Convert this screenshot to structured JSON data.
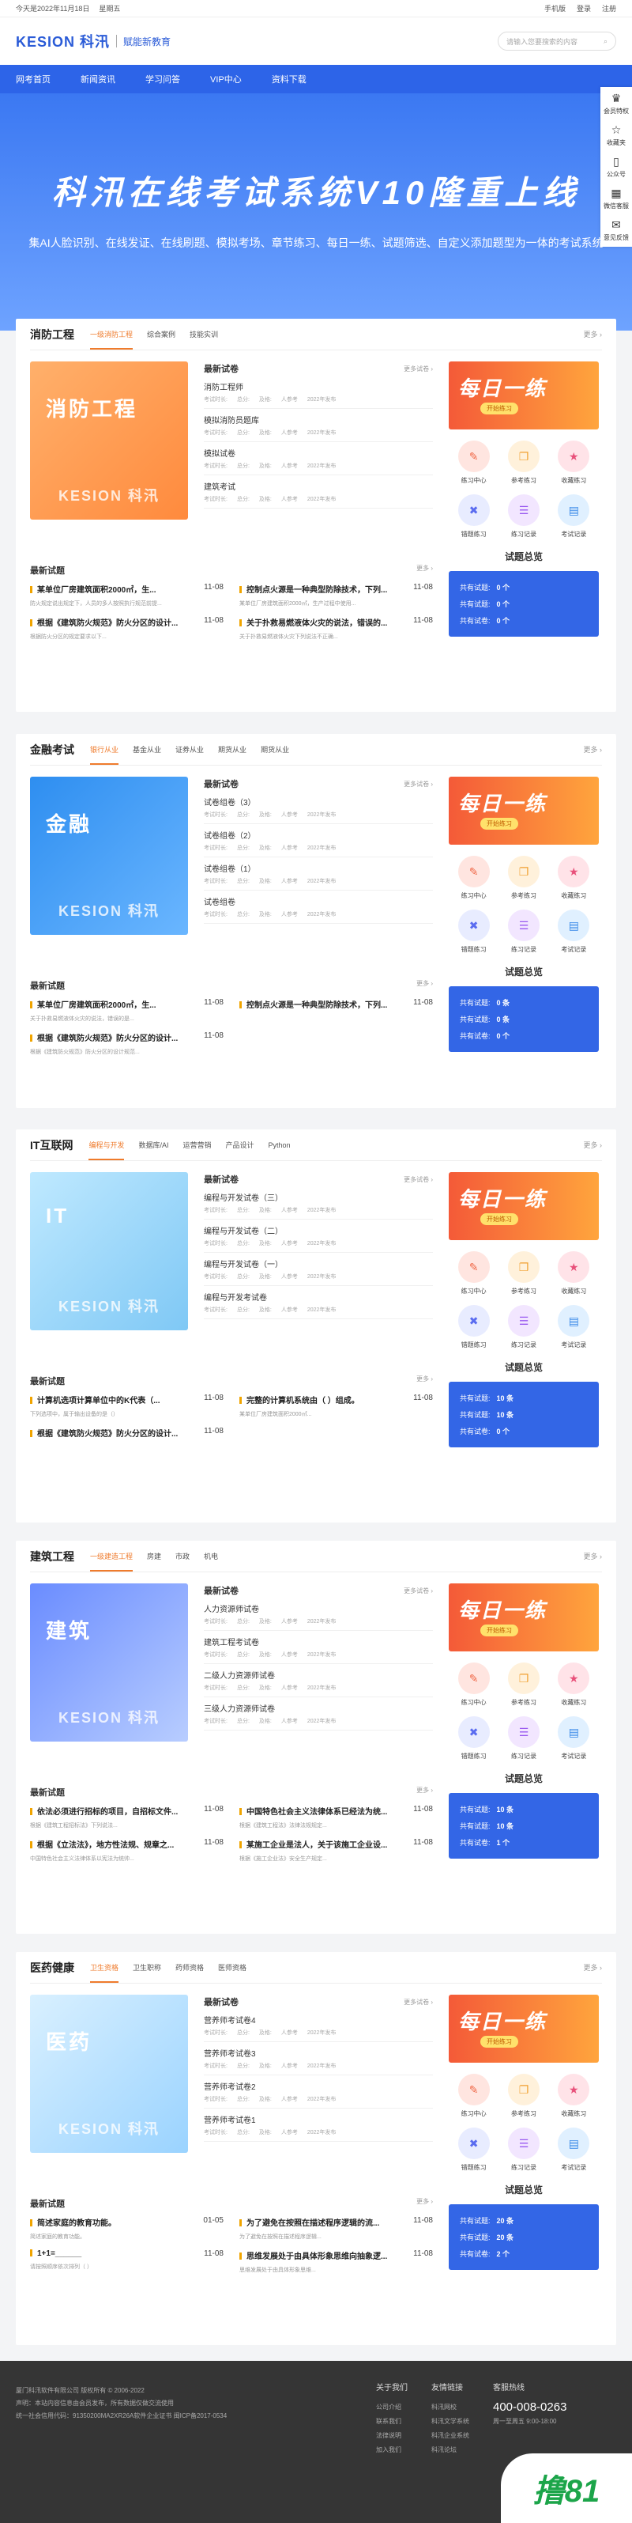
{
  "topbar": {
    "date": "今天是2022年11月18日",
    "weekday": "星期五",
    "links": [
      "手机版",
      "登录",
      "注册"
    ]
  },
  "header": {
    "brand": "KESION 科汛",
    "slogan": "赋能新教育",
    "search_placeholder": "请输入您要搜索的内容"
  },
  "nav": [
    "网考首页",
    "新闻资讯",
    "学习问答",
    "VIP中心",
    "资料下载"
  ],
  "banner": {
    "title": "科汛在线考试系统V10隆重上线",
    "subtitle": "集AI人脸识别、在线发证、在线刷题、模拟考场、章节练习、每日一练、试题筛选、自定义添加题型为一体的考试系统"
  },
  "sidebar": [
    {
      "icon": "crown-icon",
      "label": "会员特权"
    },
    {
      "icon": "star-icon",
      "label": "收藏夹"
    },
    {
      "icon": "phone-icon",
      "label": "公众号"
    },
    {
      "icon": "qrcode-icon",
      "label": "微信客服"
    },
    {
      "icon": "mail-icon",
      "label": "意见反馈"
    }
  ],
  "common": {
    "more": "更多 ›",
    "latest": "最新试卷",
    "more_exam": "更多试卷 ›",
    "latest_exam": "最新试题",
    "more_q": "更多 ›",
    "daily": "每日一练",
    "daily_btn": "开始练习",
    "summary": "试题总览",
    "icon_labels": [
      "练习中心",
      "参考练习",
      "收藏练习",
      "错题练习",
      "练习记录",
      "考试记录"
    ],
    "sum_labels": [
      "共有试题:",
      "共有试题:",
      "共有试卷:"
    ],
    "stat_labels": [
      "考试时长:",
      "总分:",
      "及格:",
      "人参考",
      "2022年发布"
    ]
  },
  "sections": [
    {
      "title": "消防工程",
      "tabs": [
        "一级消防工程",
        "综合案例",
        "技能实训"
      ],
      "img": "消防工程",
      "papers": [
        "消防工程师",
        "模拟消防员题库",
        "模拟试卷",
        "建筑考试"
      ],
      "exams": [
        [
          "某单位厂房建筑面积2000㎡，生...",
          "11-08",
          "防火规定说出规定下，人员的多人按照执行规范前提..."
        ],
        [
          "控制点火源是一种典型防除技术，下列...",
          "11-08",
          "某单位厂房建筑面积2000㎡，生产过程中使用..."
        ],
        [
          "根据《建筑防火规范》防火分区的设计...",
          "11-08",
          "根据防火分区的规定要求以下..."
        ],
        [
          "关于扑救易燃液体火灾的说法，错误的...",
          "11-08",
          "关于扑救易燃液体火灾下列说法不正确..."
        ]
      ],
      "sum": [
        "0 个",
        "0 个",
        "0 个"
      ]
    },
    {
      "title": "金融考试",
      "tabs": [
        "银行从业",
        "基金从业",
        "证券从业",
        "期货从业",
        "期货从业"
      ],
      "img": "金融",
      "papers": [
        "试卷组卷（3）",
        "试卷组卷（2）",
        "试卷组卷（1）",
        "试卷组卷"
      ],
      "exams": [
        [
          "某单位厂房建筑面积2000㎡，生...",
          "11-08",
          "关于扑救易燃液体火灾的说法，错误的是..."
        ],
        [
          "控制点火源是一种典型防除技术，下列...",
          "11-08",
          ""
        ],
        [
          "根据《建筑防火规范》防火分区的设计...",
          "11-08",
          "根据《建筑防火规范》防火分区的设计规范..."
        ]
      ],
      "sum": [
        "0 条",
        "0 条",
        "0 个"
      ]
    },
    {
      "title": "IT互联网",
      "tabs": [
        "编程与开发",
        "数据库/AI",
        "运营营销",
        "产品设计",
        "Python"
      ],
      "img": "IT",
      "papers": [
        "编程与开发试卷（三）",
        "编程与开发试卷（二）",
        "编程与开发试卷（一）",
        "编程与开发考试卷"
      ],
      "exams": [
        [
          "计算机选项计算单位中的K代表（...",
          "11-08",
          "下列选项中，属于输出设备的是（）"
        ],
        [
          "完整的计算机系统由（  ）组成。",
          "11-08",
          "某单位厂房建筑面积2000㎡..."
        ],
        [
          "根据《建筑防火规范》防火分区的设计...",
          "11-08",
          ""
        ]
      ],
      "sum": [
        "10 条",
        "10 条",
        "0 个"
      ]
    },
    {
      "title": "建筑工程",
      "tabs": [
        "一级建造工程",
        "房建",
        "市政",
        "机电"
      ],
      "img": "建筑",
      "papers": [
        "人力资源师试卷",
        "建筑工程考试卷",
        "二级人力资源师试卷",
        "三级人力资源师试卷"
      ],
      "exams": [
        [
          "依法必须进行招标的项目，自招标文件...",
          "11-08",
          "根据《建筑工程招标法》下列说法..."
        ],
        [
          "中国特色社会主义法律体系已经法为统...",
          "11-08",
          "根据《建筑工程法》法律法规规定..."
        ],
        [
          "根据《立法法》，地方性法规、规章之...",
          "11-08",
          "中国特色社会主义法律体系以宪法为统帅..."
        ],
        [
          "某施工企业是法人，关于该施工企业设...",
          "11-08",
          "根据《施工企业法》安全生产规定..."
        ]
      ],
      "sum": [
        "10 条",
        "10 条",
        "1 个"
      ]
    },
    {
      "title": "医药健康",
      "tabs": [
        "卫生资格",
        "卫生职称",
        "药师资格",
        "医师资格"
      ],
      "img": "医药",
      "papers": [
        "营养师考试卷4",
        "营养师考试卷3",
        "营养师考试卷2",
        "营养师考试卷1"
      ],
      "exams": [
        [
          "简述家庭的教育功能。",
          "01-05",
          "简述家庭的教育功能。"
        ],
        [
          "为了避免在按照在描述程序逻辑的流...",
          "11-08",
          "为了避免在按照在描述程序逻辑..."
        ],
        [
          "1+1=______",
          "11-08",
          "请按照顺序依次排列（  ）"
        ],
        [
          "思维发展处于由具体形象思维向抽象逻...",
          "11-08",
          "思维发展处于由具体形象思维..."
        ]
      ],
      "sum": [
        "20 条",
        "20 条",
        "2 个"
      ]
    }
  ],
  "footer": {
    "copy": "厦门科汛软件有限公司 版权所有 © 2006-2022",
    "desc": "声明：本站内容信息由会员发布，所有数据仅做交流使用",
    "icp": "统一社会信用代码：91350200MA2XR26A软件企业证书 闽ICP备2017-0534",
    "cols": [
      {
        "h": "关于我们",
        "items": [
          "公司介绍",
          "联系我们",
          "法律说明",
          "加入我们"
        ]
      },
      {
        "h": "友情链接",
        "items": [
          "科汛网校",
          "科汛文学系统",
          "科汛企业系统",
          "科汛论坛"
        ]
      },
      {
        "h": "客服热线",
        "items": [
          "400-008-0263",
          "周一至周五 9:00-18:00"
        ]
      }
    ]
  },
  "watermark": "撸81"
}
